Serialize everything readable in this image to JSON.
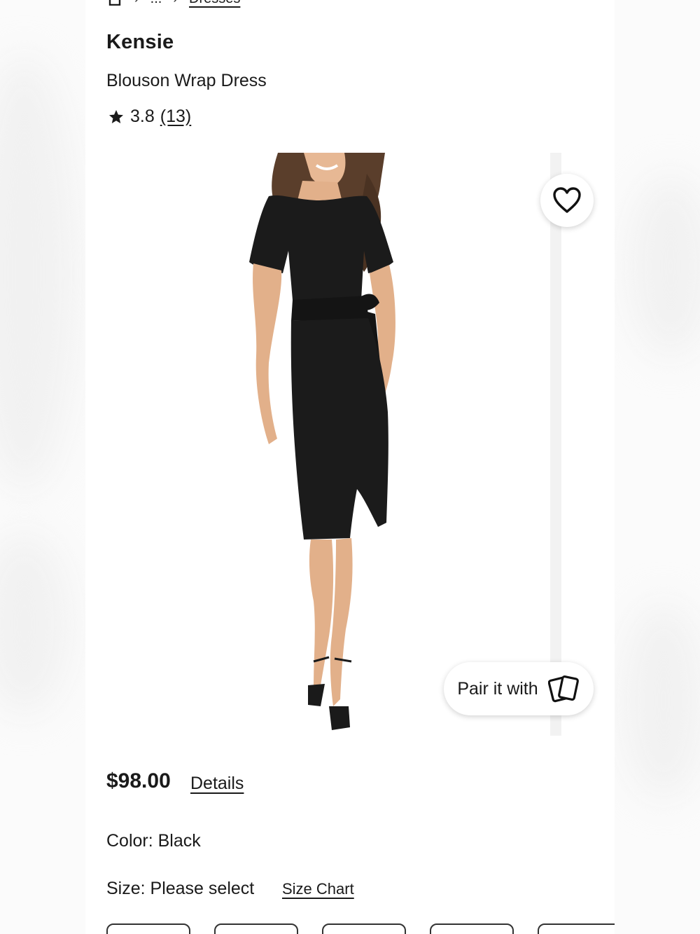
{
  "breadcrumb": {
    "items": [
      {
        "label": "",
        "icon": "home-icon"
      },
      {
        "label": "..."
      },
      {
        "label": "Dresses",
        "link": true
      }
    ],
    "separator": "›"
  },
  "product": {
    "brand": "Kensie",
    "name": "Blouson Wrap Dress",
    "rating": "3.8",
    "review_count": "(13)",
    "price": "$98.00",
    "details_label": "Details",
    "color_label": "Color: Black",
    "size_label": "Size: Please select",
    "size_chart_label": "Size Chart",
    "size_options": [
      "",
      "",
      "",
      "",
      ""
    ]
  },
  "gallery": {
    "wishlist_icon": "heart-icon",
    "pair_label": "Pair it with",
    "pair_icon": "cards-icon"
  }
}
